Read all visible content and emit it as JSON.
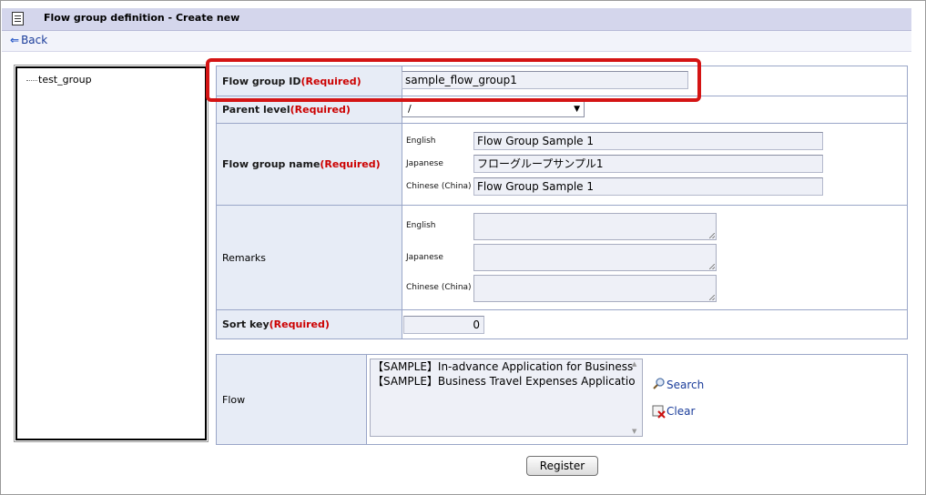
{
  "title": "Flow group definition - Create new",
  "back_label": "Back",
  "tree": {
    "node": "test_group"
  },
  "form": {
    "flow_group_id": {
      "label": "Flow group ID",
      "required": "(Required)",
      "value": "sample_flow_group1"
    },
    "parent_level": {
      "label": "Parent level",
      "required": "(Required)",
      "value": "/"
    },
    "flow_group_name": {
      "label": "Flow group name",
      "required": "(Required)",
      "langs": [
        {
          "lang": "English",
          "value": "Flow Group Sample 1"
        },
        {
          "lang": "Japanese",
          "value": "フローグループサンプル1"
        },
        {
          "lang": "Chinese (China)",
          "value": "Flow Group Sample 1"
        }
      ]
    },
    "remarks": {
      "label": "Remarks",
      "langs": [
        {
          "lang": "English",
          "value": ""
        },
        {
          "lang": "Japanese",
          "value": ""
        },
        {
          "lang": "Chinese (China)",
          "value": ""
        }
      ]
    },
    "sort_key": {
      "label": "Sort key",
      "required": "(Required)",
      "value": "0"
    },
    "flow": {
      "label": "Flow",
      "items": [
        "【SAMPLE】In-advance Application for Business",
        "【SAMPLE】Business Travel Expenses Applicatio"
      ],
      "search_label": "Search",
      "clear_label": "Clear"
    }
  },
  "register_label": "Register",
  "colors": {
    "required": "#cc0000",
    "highlight": "#d41414",
    "link": "#1a3c9a",
    "label_bg": "#e7ecf6"
  }
}
